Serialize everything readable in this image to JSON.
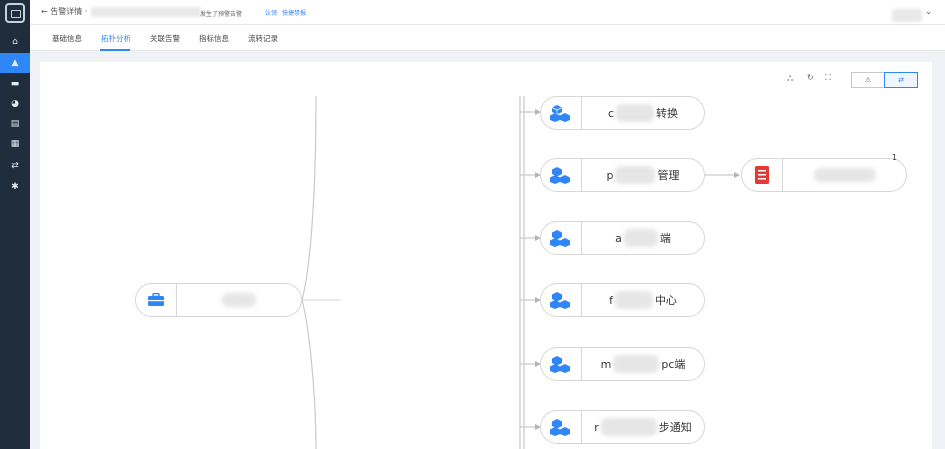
{
  "sidebar": {
    "logo": "app-logo",
    "items": [
      {
        "icon": "home-icon",
        "glyph": "⌂",
        "active": false
      },
      {
        "icon": "alert-icon",
        "glyph": "▲",
        "active": true
      },
      {
        "icon": "chat-icon",
        "glyph": "▬",
        "active": false
      },
      {
        "icon": "chart-icon",
        "glyph": "◕",
        "active": false
      },
      {
        "icon": "doc-icon",
        "glyph": "▤",
        "active": false
      },
      {
        "icon": "list-icon",
        "glyph": "▦",
        "active": false
      },
      {
        "icon": "topology-icon",
        "glyph": "⇄",
        "active": false
      },
      {
        "icon": "settings-icon",
        "glyph": "✱",
        "active": false
      }
    ]
  },
  "header": {
    "back_label": "← 告警详情 ·",
    "description": "发生了预警告警",
    "link_ack": "认领",
    "link_handle": "快捷禁报",
    "dropdown_caret": "⌄"
  },
  "tabs": [
    {
      "label": "基础信息",
      "active": false
    },
    {
      "label": "拓扑分析",
      "active": true
    },
    {
      "label": "关联告警",
      "active": false
    },
    {
      "label": "指标信息",
      "active": false
    },
    {
      "label": "流转记录",
      "active": false
    }
  ],
  "toolbar": {
    "layout_icon": "ஃ",
    "refresh_icon": "↻",
    "fullscreen_icon": "⛶",
    "view_tree_icon": "⚠",
    "view_graph_icon": "⇄"
  },
  "topology": {
    "root": {
      "icon": "toolbox-icon",
      "label": ""
    },
    "children": [
      {
        "prefix": "c",
        "suffix": "转换"
      },
      {
        "prefix": "p",
        "suffix": "管理"
      },
      {
        "prefix": "a",
        "suffix": "端"
      },
      {
        "prefix": "f",
        "suffix": "中心"
      },
      {
        "prefix": "m",
        "suffix": "pc端"
      },
      {
        "prefix": "r",
        "suffix": "步通知"
      }
    ],
    "leaf": {
      "icon": "server-icon",
      "label": "",
      "count": "1"
    }
  },
  "colors": {
    "accent": "#2f86f6",
    "sidebar": "#1f2d3d",
    "server": "#e53935"
  }
}
